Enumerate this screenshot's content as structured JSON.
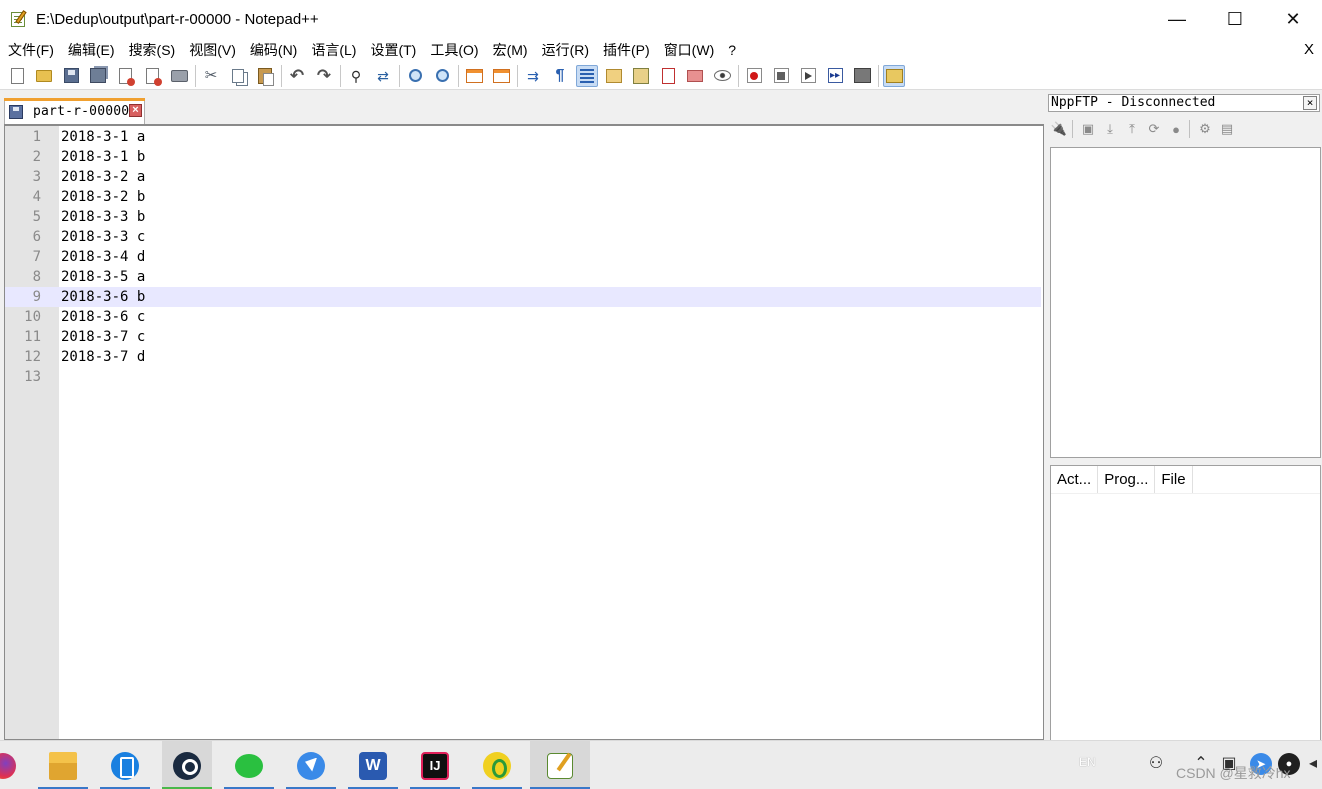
{
  "window": {
    "title": "E:\\Dedup\\output\\part-r-00000 - Notepad++",
    "minimize": "—",
    "maximize": "☐",
    "close": "✕"
  },
  "menu": {
    "items": [
      "文件(F)",
      "编辑(E)",
      "搜索(S)",
      "视图(V)",
      "编码(N)",
      "语言(L)",
      "设置(T)",
      "工具(O)",
      "宏(M)",
      "运行(R)",
      "插件(P)",
      "窗口(W)",
      "?"
    ],
    "close_doc": "X"
  },
  "toolbar": {
    "icons": [
      "new-file-icon",
      "open-file-icon",
      "save-icon",
      "save-all-icon",
      "close-icon",
      "close-all-icon",
      "print-icon",
      "cut-icon",
      "copy-icon",
      "paste-icon",
      "undo-icon",
      "redo-icon",
      "find-icon",
      "replace-icon",
      "zoom-in-icon",
      "zoom-out-icon",
      "sync-vertical-icon",
      "sync-horizontal-icon",
      "word-wrap-icon",
      "show-all-characters-icon",
      "indent-guide-icon",
      "user-defined-language-icon",
      "document-map-icon",
      "function-list-icon",
      "folder-as-workspace-icon",
      "monitoring-icon",
      "macro-record-icon",
      "macro-stop-icon",
      "macro-play-icon",
      "macro-run-multiple-icon",
      "macro-save-icon",
      "nppftp-icon"
    ],
    "active": [
      "indent-guide-icon",
      "nppftp-icon"
    ]
  },
  "tab": {
    "label": "part-r-00000",
    "close": "×"
  },
  "editor": {
    "current_line": 9,
    "lines": [
      {
        "num": "1",
        "text": "2018-3-1 a"
      },
      {
        "num": "2",
        "text": "2018-3-1 b"
      },
      {
        "num": "3",
        "text": "2018-3-2 a"
      },
      {
        "num": "4",
        "text": "2018-3-2 b"
      },
      {
        "num": "5",
        "text": "2018-3-3 b"
      },
      {
        "num": "6",
        "text": "2018-3-3 c"
      },
      {
        "num": "7",
        "text": "2018-3-4 d"
      },
      {
        "num": "8",
        "text": "2018-3-5 a"
      },
      {
        "num": "9",
        "text": "2018-3-6 b"
      },
      {
        "num": "10",
        "text": "2018-3-6 c"
      },
      {
        "num": "11",
        "text": "2018-3-7 c"
      },
      {
        "num": "12",
        "text": "2018-3-7 d"
      },
      {
        "num": "13",
        "text": ""
      }
    ]
  },
  "ftp": {
    "title": "NppFTP - Disconnected",
    "close": "×",
    "queue_headers": [
      "Act...",
      "Prog...",
      "File"
    ]
  },
  "taskbar": {
    "apps": [
      {
        "name": "firefox"
      },
      {
        "name": "file-explorer"
      },
      {
        "name": "phone-link"
      },
      {
        "name": "steam"
      },
      {
        "name": "wechat"
      },
      {
        "name": "feishu"
      },
      {
        "name": "word",
        "glyph": "W"
      },
      {
        "name": "intellij-idea",
        "glyph": "IJ"
      },
      {
        "name": "qq-music"
      },
      {
        "name": "notepad-plus-plus"
      }
    ],
    "tray_lang": "EN",
    "watermark": "CSDN @星救冷hx"
  },
  "colors": {
    "current_line_bg": "#e8e8ff",
    "gutter_bg": "#e4e4e4",
    "tab_accent": "#f0a030"
  }
}
